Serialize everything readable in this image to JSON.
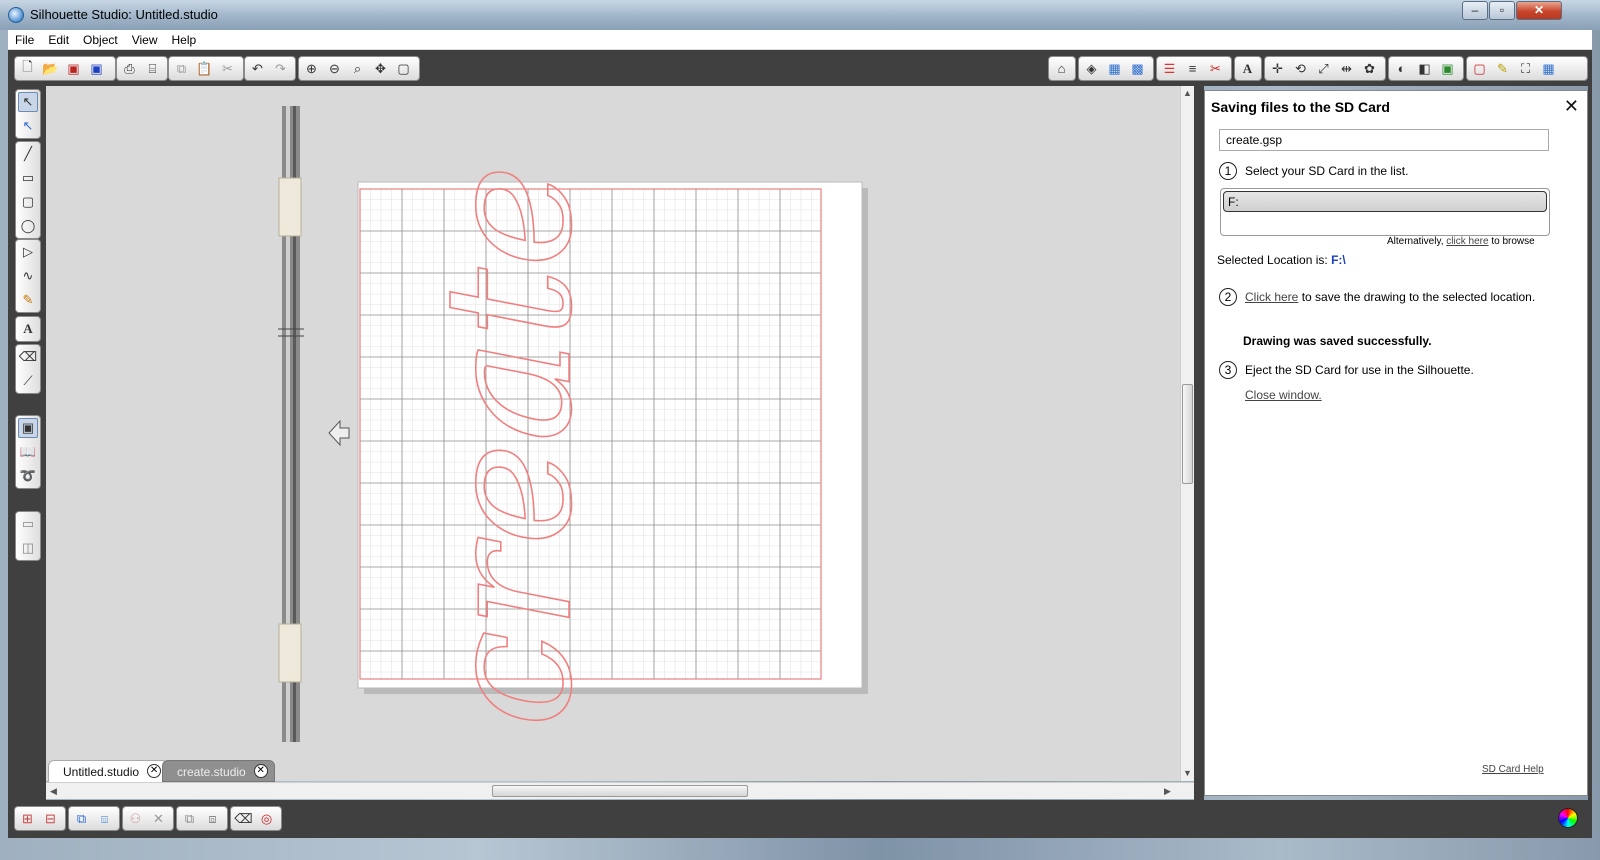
{
  "window": {
    "title": "Silhouette Studio: Untitled.studio"
  },
  "menu": [
    "File",
    "Edit",
    "Object",
    "View",
    "Help"
  ],
  "tabs": [
    {
      "label": "Untitled.studio",
      "active": true
    },
    {
      "label": "create.studio",
      "active": false
    }
  ],
  "design": {
    "text": "create",
    "color": "#f08080"
  },
  "panel": {
    "title": "Saving files to the SD Card",
    "filename": "create.gsp",
    "step1_num": "1",
    "step1_text": "Select your SD Card in the list.",
    "drive": "F:",
    "alt_prefix": "Alternatively,",
    "alt_link": "click here",
    "alt_suffix": "to browse",
    "location_label": "Selected Location is:",
    "location_value": "F:\\",
    "step2_num": "2",
    "step2_link": "Click here",
    "step2_text": "to save the drawing to the selected location.",
    "success": "Drawing was saved successfully.",
    "step3_num": "3",
    "step3_text": "Eject the SD Card for use in the Silhouette.",
    "close_link": "Close window.",
    "help_link": "SD Card Help"
  },
  "icons": {
    "top": [
      "new-document-icon",
      "open-folder-icon",
      "save-icon",
      "save-to-sd-icon",
      "print-icon",
      "cut-settings-icon",
      "copy-icon",
      "paste-icon",
      "scissors-icon",
      "undo-icon",
      "redo-icon",
      "zoom-in-icon",
      "zoom-out-icon",
      "zoom-select-icon",
      "pan-icon",
      "fit-page-icon"
    ],
    "accent": "#1a3fc2"
  }
}
